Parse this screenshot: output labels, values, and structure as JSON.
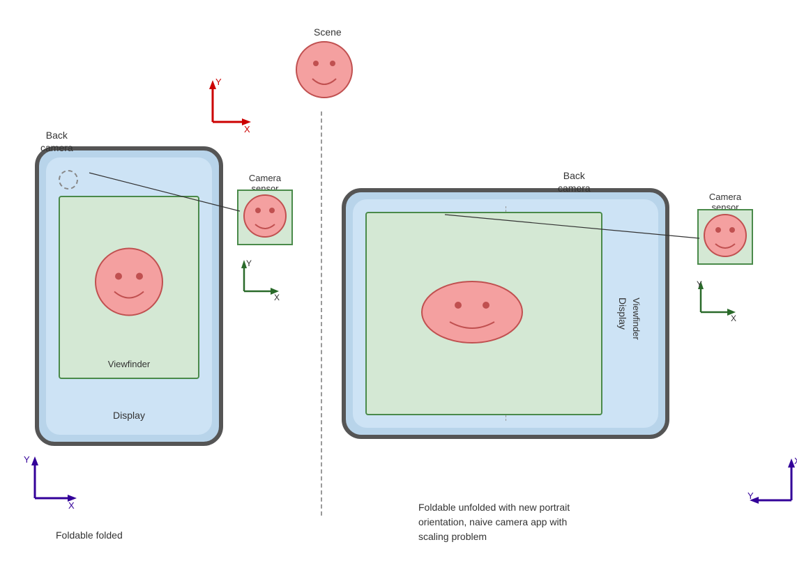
{
  "scene": {
    "label": "Scene"
  },
  "top_coords": {
    "y_label": "Y",
    "x_label": "X"
  },
  "left_phone": {
    "back_camera_label": "Back\ncamera",
    "viewfinder_label": "Viewfinder",
    "display_label": "Display",
    "camera_sensor_label": "Camera\nsensor",
    "caption": "Foldable folded",
    "sensor_y": "Y",
    "sensor_x": "X",
    "bottom_y": "Y",
    "bottom_x": "X"
  },
  "right_phone": {
    "back_camera_label": "Back\ncamera",
    "viewfinder_label": "Viewfinder",
    "display_label": "Display",
    "camera_sensor_label": "Camera\nsensor",
    "caption": "Foldable unfolded with new portrait\norientation, naive camera app with\nscaling problem",
    "sensor_y": "Y",
    "sensor_x": "X",
    "bottom_y": "Y",
    "bottom_x": "X"
  },
  "colors": {
    "phone_bg": "#b8d4ea",
    "phone_inner": "#cde3f5",
    "viewfinder_bg": "#d4e8d4",
    "viewfinder_border": "#4a8a4a",
    "face_fill": "#f4a0a0",
    "face_stroke": "#c05050",
    "arrow_red": "#cc0000",
    "arrow_dark_green": "#2a6a2a",
    "arrow_purple": "#330099"
  }
}
